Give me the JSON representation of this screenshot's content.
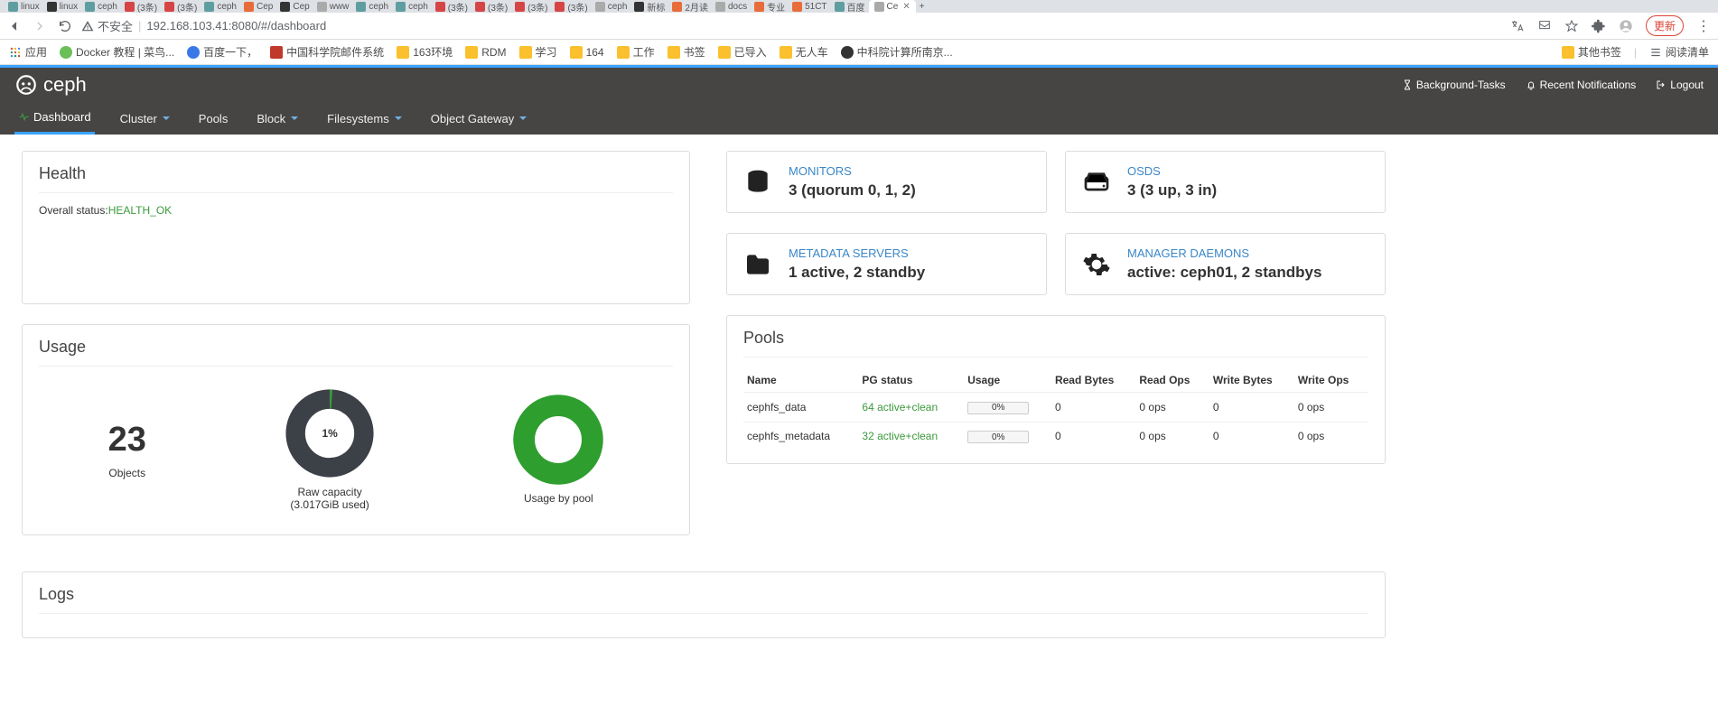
{
  "browser": {
    "tabs": [
      {
        "label": "linux"
      },
      {
        "label": "linux"
      },
      {
        "label": "ceph"
      },
      {
        "label": "(3条)"
      },
      {
        "label": "(3条)"
      },
      {
        "label": "ceph"
      },
      {
        "label": "Cep"
      },
      {
        "label": "Cep"
      },
      {
        "label": "www"
      },
      {
        "label": "ceph"
      },
      {
        "label": "ceph"
      },
      {
        "label": "(3条)"
      },
      {
        "label": "(3条)"
      },
      {
        "label": "(3条)"
      },
      {
        "label": "(3条)"
      },
      {
        "label": "ceph"
      },
      {
        "label": "新标"
      },
      {
        "label": "2月读"
      },
      {
        "label": "docs"
      },
      {
        "label": "专业"
      },
      {
        "label": "51CT"
      },
      {
        "label": "百度"
      },
      {
        "label": "Ce",
        "active": true
      }
    ],
    "new_tab": "+",
    "insecure": "不安全",
    "url": "192.168.103.41:8080/#/dashboard",
    "update": "更新"
  },
  "bookmarks": {
    "apps": "应用",
    "items": [
      "Docker 教程 | 菜鸟...",
      "百度一下，",
      "中国科学院邮件系统",
      "163环境",
      "RDM",
      "学习",
      "164",
      "工作",
      "书签",
      "已导入",
      "无人车",
      "中科院计算所南京..."
    ],
    "other": "其他书签",
    "reading": "阅读清单"
  },
  "ceph": {
    "logo": "ceph",
    "top_links": {
      "bg": "Background-Tasks",
      "notif": "Recent Notifications",
      "logout": "Logout"
    },
    "nav": {
      "dashboard": "Dashboard",
      "cluster": "Cluster",
      "pools": "Pools",
      "block": "Block",
      "filesystems": "Filesystems",
      "gateway": "Object Gateway"
    }
  },
  "health": {
    "title": "Health",
    "overall_label": "Overall status:",
    "overall_value": "HEALTH_OK"
  },
  "stats": {
    "monitors": {
      "label": "MONITORS",
      "value": "3 (quorum 0, 1, 2)"
    },
    "osds": {
      "label": "OSDS",
      "value": "3 (3 up, 3 in)"
    },
    "mds": {
      "label": "METADATA SERVERS",
      "value": "1 active, 2 standby"
    },
    "mgr": {
      "label": "MANAGER DAEMONS",
      "value": "active: ceph01, 2 standbys"
    }
  },
  "usage": {
    "title": "Usage",
    "objects": {
      "count": "23",
      "label": "Objects"
    },
    "raw": {
      "pct": "1%",
      "label": "Raw capacity",
      "sub": "(3.017GiB used)"
    },
    "bypool": {
      "label": "Usage by pool"
    }
  },
  "pools": {
    "title": "Pools",
    "headers": {
      "name": "Name",
      "pg": "PG status",
      "usage": "Usage",
      "rb": "Read Bytes",
      "ro": "Read Ops",
      "wb": "Write Bytes",
      "wo": "Write Ops"
    },
    "rows": [
      {
        "name": "cephfs_data",
        "pg": "64 active+clean",
        "usage": "0%",
        "rb": "0",
        "ro": "0 ops",
        "wb": "0",
        "wo": "0 ops"
      },
      {
        "name": "cephfs_metadata",
        "pg": "32 active+clean",
        "usage": "0%",
        "rb": "0",
        "ro": "0 ops",
        "wb": "0",
        "wo": "0 ops"
      }
    ]
  },
  "logs": {
    "title": "Logs"
  }
}
